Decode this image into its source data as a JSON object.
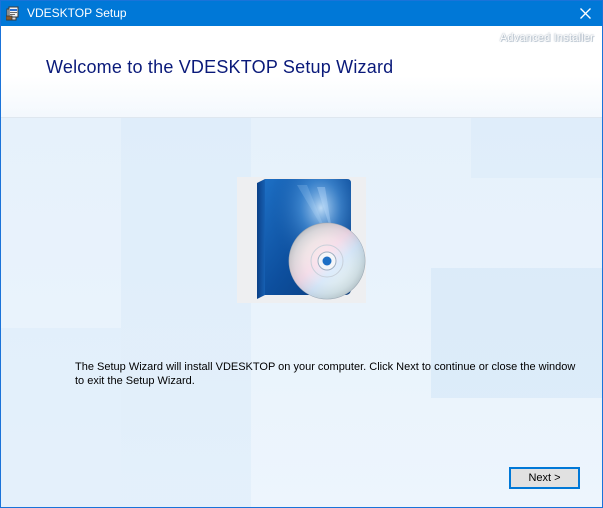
{
  "window": {
    "title": "VDESKTOP Setup",
    "icon": "installer-icon",
    "close_icon": "close-icon"
  },
  "header": {
    "brand": "Advanced Installer",
    "title": "Welcome to the VDESKTOP Setup Wizard"
  },
  "main": {
    "image": "software-box-cd-icon",
    "description": "The Setup Wizard will install VDESKTOP on your computer. Click Next to continue or close the window to exit the Setup Wizard."
  },
  "buttons": {
    "next_label": "Next >"
  },
  "colors": {
    "titlebar": "#0078d7",
    "title_text": "#0a1a7a",
    "body_bg": "#eaf4fc"
  }
}
